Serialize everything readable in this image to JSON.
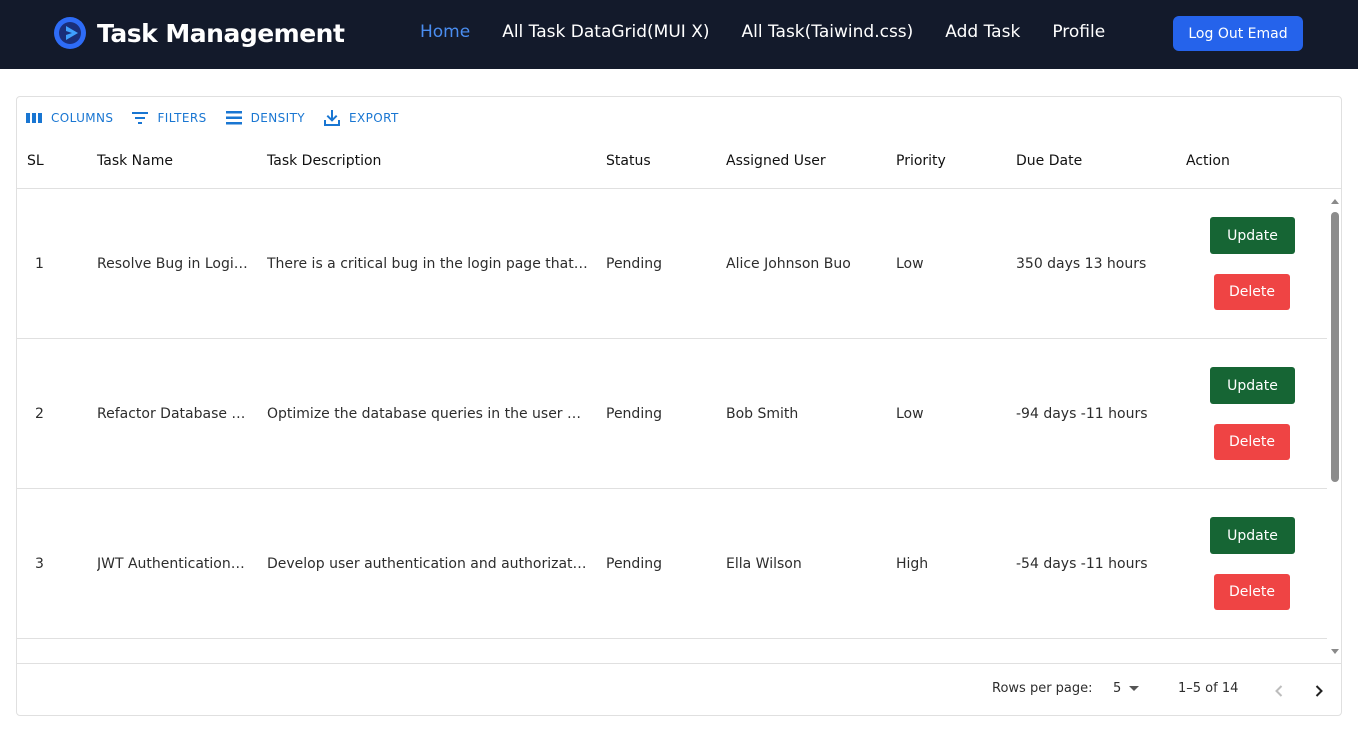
{
  "nav": {
    "brand": "Task Management",
    "links": [
      "Home",
      "All Task DataGrid(MUI X)",
      "All Task(Taiwind.css)",
      "Add Task",
      "Profile"
    ],
    "active": "Home",
    "logout_label": "Log Out Emad"
  },
  "toolbar": {
    "columns": "COLUMNS",
    "filters": "FILTERS",
    "density": "DENSITY",
    "export": "EXPORT"
  },
  "columns": [
    "SL",
    "Task Name",
    "Task Description",
    "Status",
    "Assigned User",
    "Priority",
    "Due Date",
    "Action"
  ],
  "rows": [
    {
      "sl": "1",
      "name": "Resolve Bug in Logi…",
      "description": "There is a critical bug in the login page that…",
      "status": "Pending",
      "user": "Alice Johnson Buo",
      "priority": "Low",
      "due": "350 days 13 hours",
      "update": "Update",
      "delete": "Delete"
    },
    {
      "sl": "2",
      "name": "Refactor Database …",
      "description": "Optimize the database queries in the user …",
      "status": "Pending",
      "user": "Bob Smith",
      "priority": "Low",
      "due": "-94 days -11 hours",
      "update": "Update",
      "delete": "Delete"
    },
    {
      "sl": "3",
      "name": "JWT Authentication…",
      "description": "Develop user authentication and authorizat…",
      "status": "Pending",
      "user": "Ella Wilson",
      "priority": "High",
      "due": "-54 days -11 hours",
      "update": "Update",
      "delete": "Delete"
    }
  ],
  "footer": {
    "rows_per_page_label": "Rows per page:",
    "rows_per_page": "5",
    "range": "1–5 of 14"
  },
  "colors": {
    "navbar": "#131a2b",
    "active_link": "#4a8df0",
    "logout": "#2563eb",
    "update": "#166534",
    "delete": "#ef4444",
    "toolbar": "#1976d2"
  }
}
